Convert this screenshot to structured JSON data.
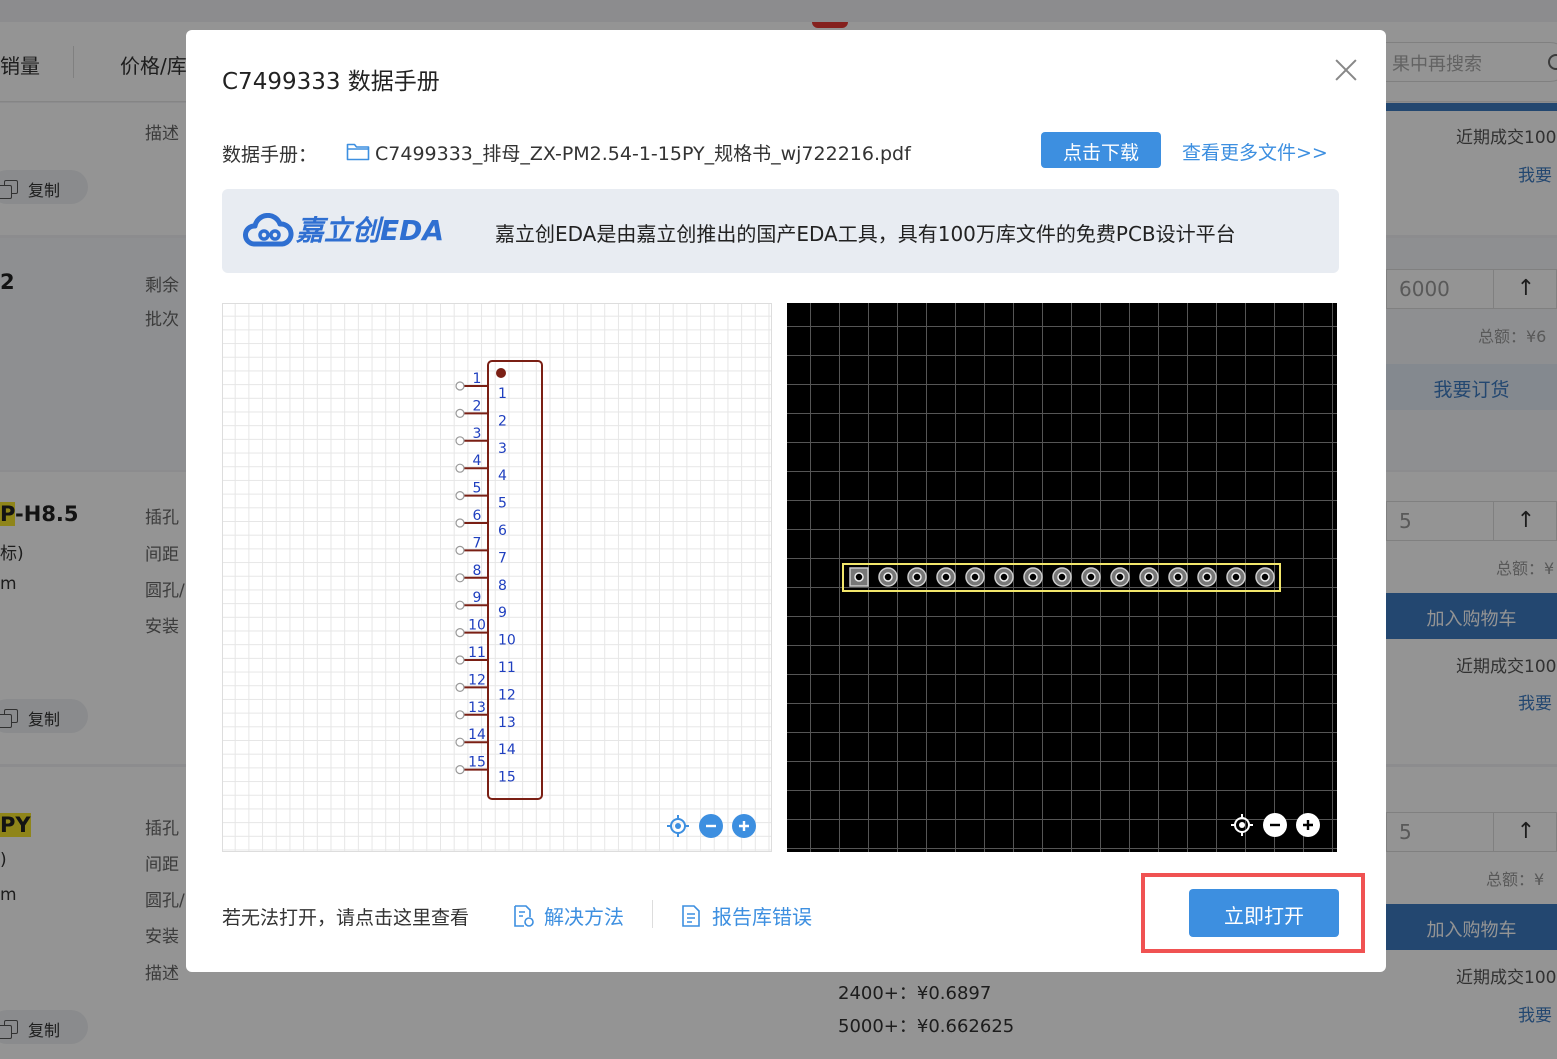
{
  "background": {
    "topbar": {
      "sales_label": "销量",
      "price_label": "价格/库",
      "search_placeholder": "果中再搜索"
    },
    "rows": [
      {
        "lines": [
          "描述"
        ],
        "copy_label": "复制",
        "deal": "近期成交100",
        "want": "我要"
      },
      {
        "pn_suffix": "2",
        "lines": [
          "剩余",
          "批次"
        ],
        "qty": "6000",
        "total": "总额：¥6",
        "order_btn": "我要订货"
      },
      {
        "pn_hl": "P",
        "pn_rest": "-H8.5",
        "sub1": "标)",
        "sub2": "m",
        "lines": [
          "插孔",
          "间距",
          "圆孔/",
          "安装"
        ],
        "copy_label": "复制",
        "qty": "5",
        "total": "总额：¥",
        "cart_btn": "加入购物车",
        "deal": "近期成交100",
        "want": "我要"
      },
      {
        "pn_hl": "PY",
        "sub1": ")",
        "sub2": "m",
        "lines": [
          "插孔",
          "间距",
          "圆孔/",
          "安装",
          "描述"
        ],
        "copy_label": "复制",
        "qty": "5",
        "total": "总额：¥",
        "cart_btn": "加入购物车",
        "deal": "近期成交100",
        "want": "我要"
      }
    ],
    "prices": [
      "2400+：¥0.6897",
      "5000+：¥0.662625"
    ]
  },
  "modal": {
    "title": "C7499333 数据手册",
    "datasheet_label": "数据手册：",
    "filename": "C7499333_排母_ZX-PM2.54-1-15PY_规格书_wj722216.pdf",
    "download_label": "点击下载",
    "more_files_label": "查看更多文件>>",
    "banner": {
      "logo_text": "嘉立创EDA",
      "description": "嘉立创EDA是由嘉立创推出的国产EDA工具，具有100万库文件的免费PCB设计平台"
    },
    "schematic": {
      "pins": [
        "1",
        "2",
        "3",
        "4",
        "5",
        "6",
        "7",
        "8",
        "9",
        "10",
        "11",
        "12",
        "13",
        "14",
        "15"
      ]
    },
    "pcb": {
      "pad_count": 15
    },
    "footer": {
      "hint": "若无法打开，请点击这里查看",
      "solution_label": "解决方法",
      "report_label": "报告库错误",
      "open_label": "立即打开"
    },
    "colors": {
      "accent": "#3d8fe0",
      "highlight": "#f05252",
      "symbol": "#7a1f14",
      "pin_label": "#1f3fbf",
      "silkscreen": "#f2e66b"
    }
  }
}
